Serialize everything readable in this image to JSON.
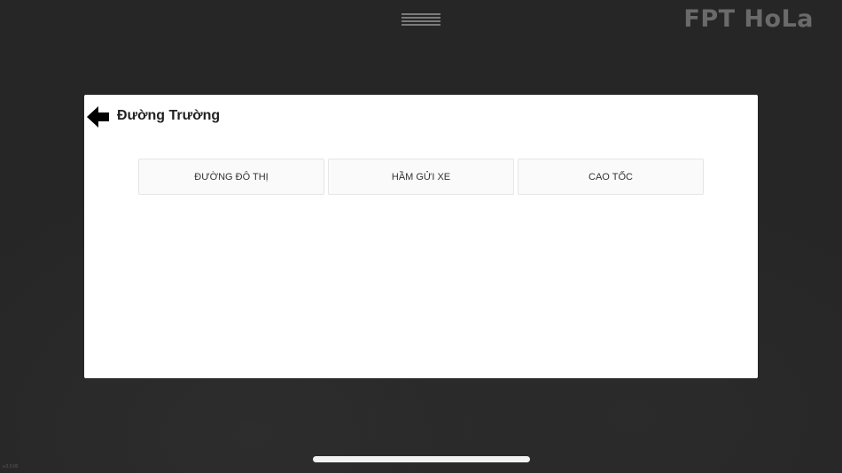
{
  "app": {
    "brand": "FPT HoLa",
    "corner_label": "v.0.0.00"
  },
  "header": {
    "menu_icon": "hamburger-menu-icon"
  },
  "dialog": {
    "back_icon": "arrow-left-icon",
    "title": "Đường Trường",
    "options": [
      {
        "label": "ĐƯỜNG ĐÔ THỊ"
      },
      {
        "label": "HẦM GỬI XE"
      },
      {
        "label": "CAO TỐC"
      }
    ]
  },
  "colors": {
    "background": "#262626",
    "dialog_background": "#ffffff",
    "button_background": "#fafafa",
    "logo": "#6a6a6a"
  }
}
